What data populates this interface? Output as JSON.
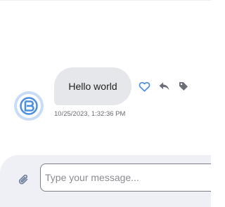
{
  "message": {
    "text": "Hello world",
    "timestamp": "10/25/2023, 1:32:36 PM"
  },
  "message_actions": [
    "like-icon",
    "reply-icon",
    "tag-icon"
  ],
  "composer": {
    "placeholder": "Type your message..."
  },
  "colors": {
    "accent": "#4a8ee0",
    "bubble": "#e6e7eb",
    "avatar_ring": "#c9dcf5",
    "composer_bg": "#eef0f6",
    "icon_gray": "#6b6f78"
  }
}
